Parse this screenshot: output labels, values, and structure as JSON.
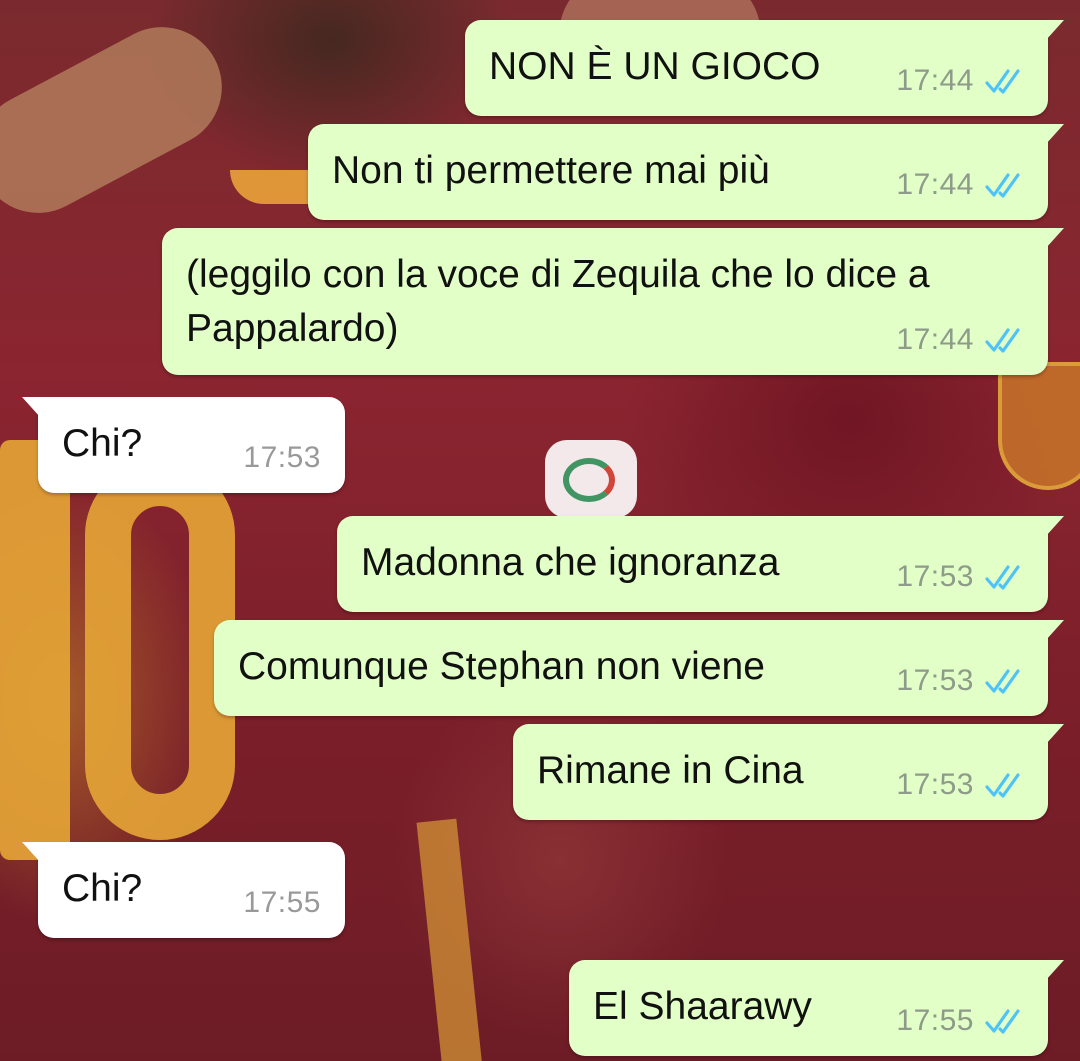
{
  "colors": {
    "outgoing_bubble": "#e1ffc7",
    "incoming_bubble": "#ffffff",
    "read_ticks": "#4fc3f7",
    "timestamp": "#8e9a8a"
  },
  "messages": [
    {
      "direction": "outgoing",
      "text": "NON È UN GIOCO",
      "time": "17:44",
      "status_icon": "double-check-read-icon"
    },
    {
      "direction": "outgoing",
      "text": "Non ti permettere mai più",
      "time": "17:44",
      "status_icon": "double-check-read-icon"
    },
    {
      "direction": "outgoing",
      "text": "(leggilo con la voce di Zequila che lo dice a\nPappalardo)",
      "time": "17:44",
      "status_icon": "double-check-read-icon"
    },
    {
      "direction": "incoming",
      "text": "Chi?",
      "time": "17:53"
    },
    {
      "direction": "outgoing",
      "text": "Madonna che ignoranza",
      "time": "17:53",
      "status_icon": "double-check-read-icon"
    },
    {
      "direction": "outgoing",
      "text": "Comunque Stephan non viene",
      "time": "17:53",
      "status_icon": "double-check-read-icon"
    },
    {
      "direction": "outgoing",
      "text": "Rimane in Cina",
      "time": "17:53",
      "status_icon": "double-check-read-icon"
    },
    {
      "direction": "incoming",
      "text": "Chi?",
      "time": "17:55"
    },
    {
      "direction": "outgoing",
      "text": "El Shaarawy",
      "time": "17:55",
      "status_icon": "double-check-read-icon"
    }
  ]
}
